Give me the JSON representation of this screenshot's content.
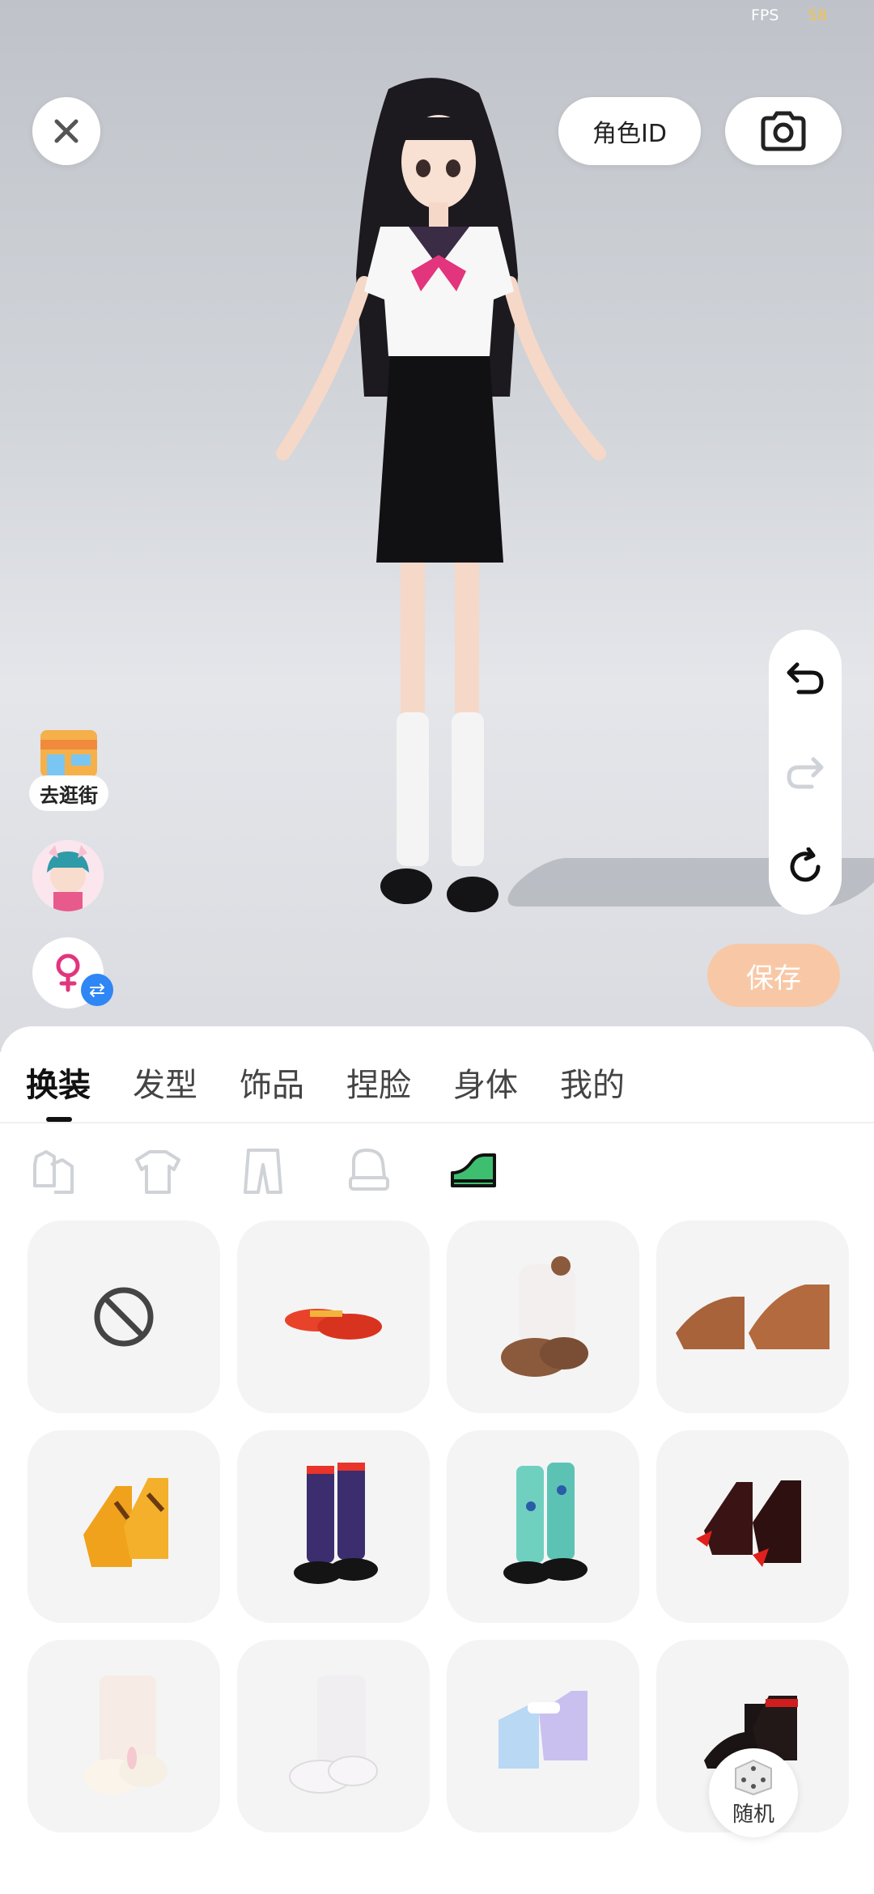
{
  "status": {
    "fps_label": "FPS",
    "fps_value": "58"
  },
  "header": {
    "role_id_label": "角色ID"
  },
  "side": {
    "shop_label": "去逛街"
  },
  "actions": {
    "save_label": "保存",
    "random_label": "随机"
  },
  "tabs": [
    {
      "label": "换装",
      "active": true
    },
    {
      "label": "发型",
      "active": false
    },
    {
      "label": "饰品",
      "active": false
    },
    {
      "label": "捏脸",
      "active": false
    },
    {
      "label": "身体",
      "active": false
    },
    {
      "label": "我的",
      "active": false
    }
  ],
  "categories": [
    {
      "icon": "outfit-set-icon",
      "active": false
    },
    {
      "icon": "top-shirt-icon",
      "active": false
    },
    {
      "icon": "pants-icon",
      "active": false
    },
    {
      "icon": "glove-icon",
      "active": false
    },
    {
      "icon": "shoe-icon",
      "active": true
    }
  ],
  "items": [
    {
      "icon": "none-icon"
    },
    {
      "icon": "red-flat-shoes-icon"
    },
    {
      "icon": "bear-fur-boots-icon"
    },
    {
      "icon": "brown-paw-shoes-icon"
    },
    {
      "icon": "yellow-tiger-boots-icon"
    },
    {
      "icon": "argyle-socks-shoes-icon"
    },
    {
      "icon": "teal-socks-shoes-icon"
    },
    {
      "icon": "red-claw-shoes-icon"
    },
    {
      "icon": "bunny-slippers-icon"
    },
    {
      "icon": "white-cat-slippers-icon"
    },
    {
      "icon": "holo-ankle-boots-icon"
    },
    {
      "icon": "black-red-boots-icon"
    }
  ],
  "colors": {
    "accent_green": "#3dbf6f",
    "save_bg": "#f8c8a6",
    "swap_blue": "#2f86f5"
  }
}
